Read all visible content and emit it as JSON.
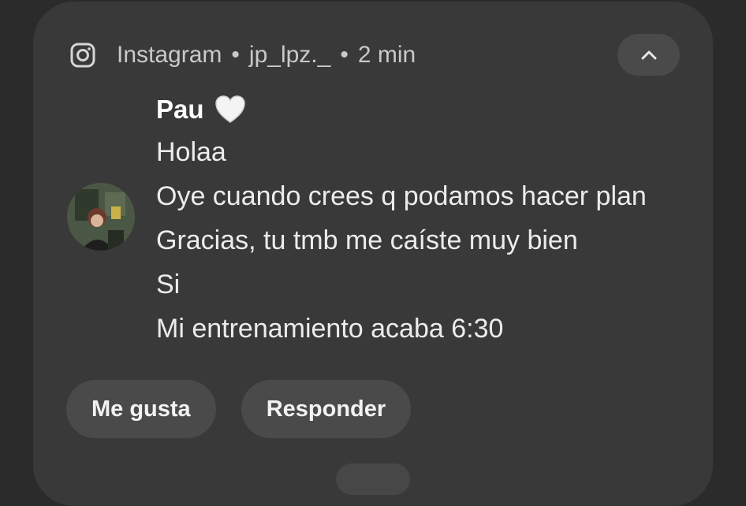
{
  "notification": {
    "app_name": "Instagram",
    "account": "jp_lpz._",
    "separator": "•",
    "time": "2 min",
    "app_icon": "instagram-icon",
    "collapse_icon": "chevron-up-icon",
    "sender_name": "Pau",
    "sender_emoji": "white-heart-icon",
    "messages": [
      "Holaa",
      "Oye cuando crees q podamos hacer plan",
      "Gracias, tu tmb me caíste muy bien",
      "Si",
      "Mi entrenamiento acaba 6:30"
    ],
    "actions": {
      "like_label": "Me gusta",
      "reply_label": "Responder"
    }
  },
  "colors": {
    "background": "#2b2b2b",
    "card": "#393939",
    "pill": "#4a4a4a",
    "text": "#ececec",
    "subtle_text": "#c9c9c9"
  }
}
